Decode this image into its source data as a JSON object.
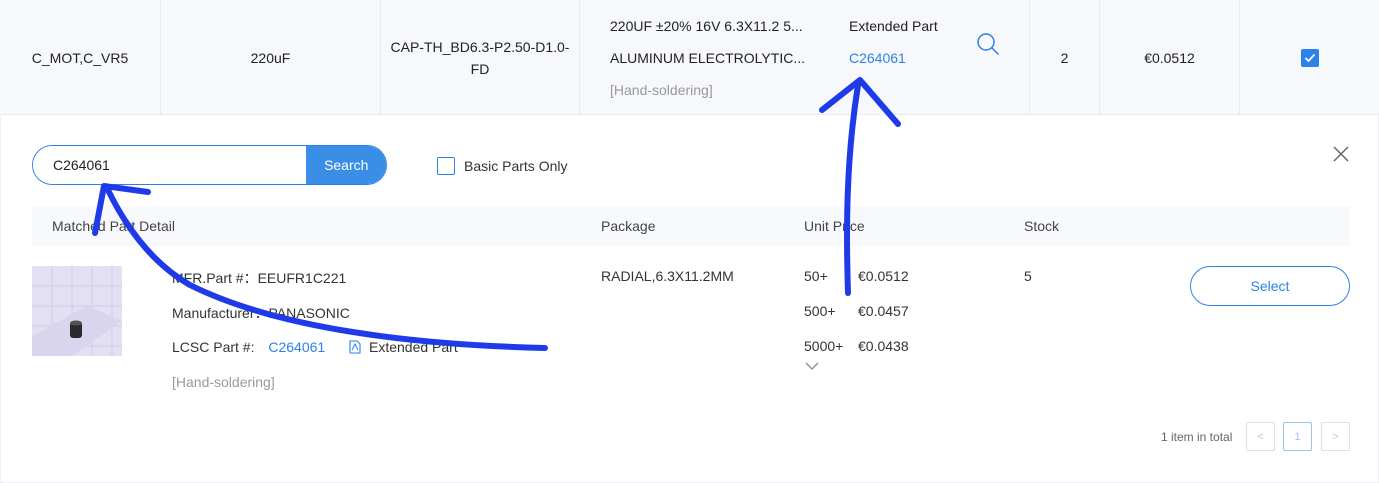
{
  "bom_row": {
    "designator": "C_MOT,C_VR5",
    "value": "220uF",
    "footprint": "CAP-TH_BD6.3-P2.50-D1.0-FD",
    "description_line1": "220UF ±20% 16V 6.3X11.2 5...",
    "description_line2": "ALUMINUM ELECTROLYTIC...",
    "description_note": "[Hand-soldering]",
    "part_type": "Extended Part",
    "part_link": "C264061",
    "quantity": "2",
    "price": "€0.0512",
    "selected": true
  },
  "search": {
    "value": "C264061",
    "button_label": "Search",
    "basic_parts_label": "Basic Parts Only"
  },
  "table": {
    "headers": [
      "Matched Part Detail",
      "Package",
      "Unit Price",
      "Stock"
    ]
  },
  "result": {
    "mfr_label": "MFR.Part #：",
    "mfr_value": "EEUFR1C221",
    "manufacturer_label": "Manufacturer：",
    "manufacturer_value": "PANASONIC",
    "lcsc_label": "LCSC Part #:",
    "lcsc_value": "C264061",
    "part_type": "Extended Part",
    "note": "[Hand-soldering]",
    "package": "RADIAL,6.3X11.2MM",
    "prices": [
      {
        "qty": "50+",
        "price": "€0.0512"
      },
      {
        "qty": "500+",
        "price": "€0.0457"
      },
      {
        "qty": "5000+",
        "price": "€0.0438"
      }
    ],
    "stock": "5",
    "select_label": "Select"
  },
  "pagination": {
    "total_text": "1 item in total",
    "prev": "<",
    "current": "1",
    "next": ">"
  },
  "colors": {
    "accent": "#2c82e8",
    "annotation": "#1f3be8"
  }
}
